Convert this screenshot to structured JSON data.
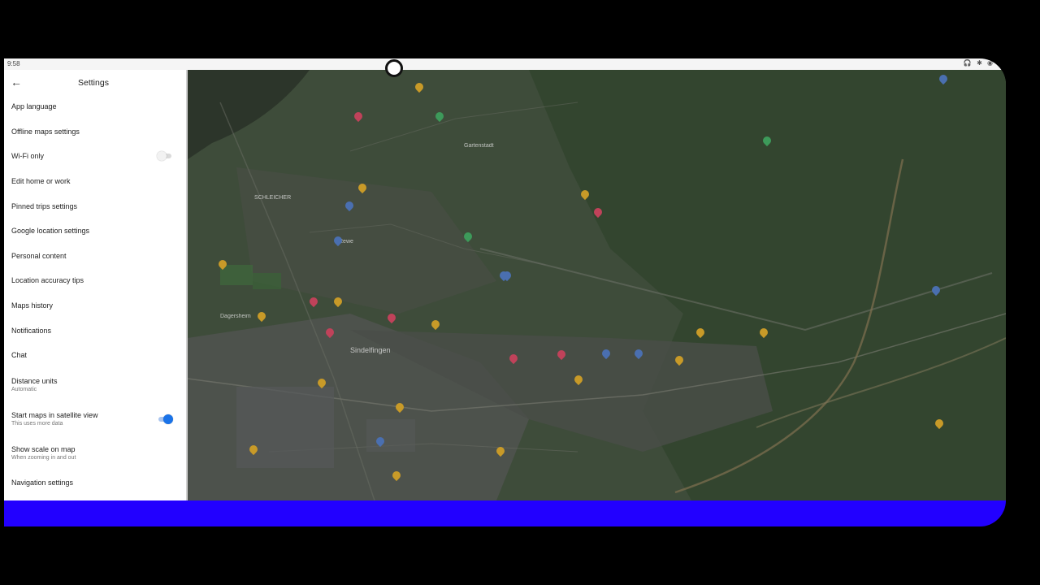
{
  "status": {
    "time": "9:58",
    "icons": "🎧 ✱ ◉"
  },
  "settings": {
    "title": "Settings",
    "back_icon": "arrow-left-icon",
    "items": [
      {
        "label": "App language"
      },
      {
        "label": "Offline maps settings"
      },
      {
        "label": "Wi-Fi only",
        "toggle": "off"
      },
      {
        "label": "Edit home or work"
      },
      {
        "label": "Pinned trips settings"
      },
      {
        "label": "Google location settings"
      },
      {
        "label": "Personal content"
      },
      {
        "label": "Location accuracy tips"
      },
      {
        "label": "Maps history"
      },
      {
        "label": "Notifications"
      },
      {
        "label": "Chat"
      },
      {
        "label": "Distance units",
        "sub": "Automatic"
      },
      {
        "label": "Start maps in satellite view",
        "sub": "This uses more data",
        "toggle": "on"
      },
      {
        "label": "Show scale on map",
        "sub": "When zooming in and out"
      },
      {
        "label": "Navigation settings"
      }
    ]
  },
  "map": {
    "labels": [
      "SCHLEICHER",
      "Sindelfingen",
      "Rewe",
      "Dagersheim",
      "Gartenstadt"
    ],
    "colors": {
      "pin_yellow": "#c89a28",
      "pin_red": "#c0425a",
      "pin_blue": "#4a6fb0",
      "pin_green": "#3d9a5a",
      "forest": "#33452f"
    }
  },
  "colors": {
    "accent": "#1a73e8",
    "bottom_bar": "#2200ff"
  }
}
